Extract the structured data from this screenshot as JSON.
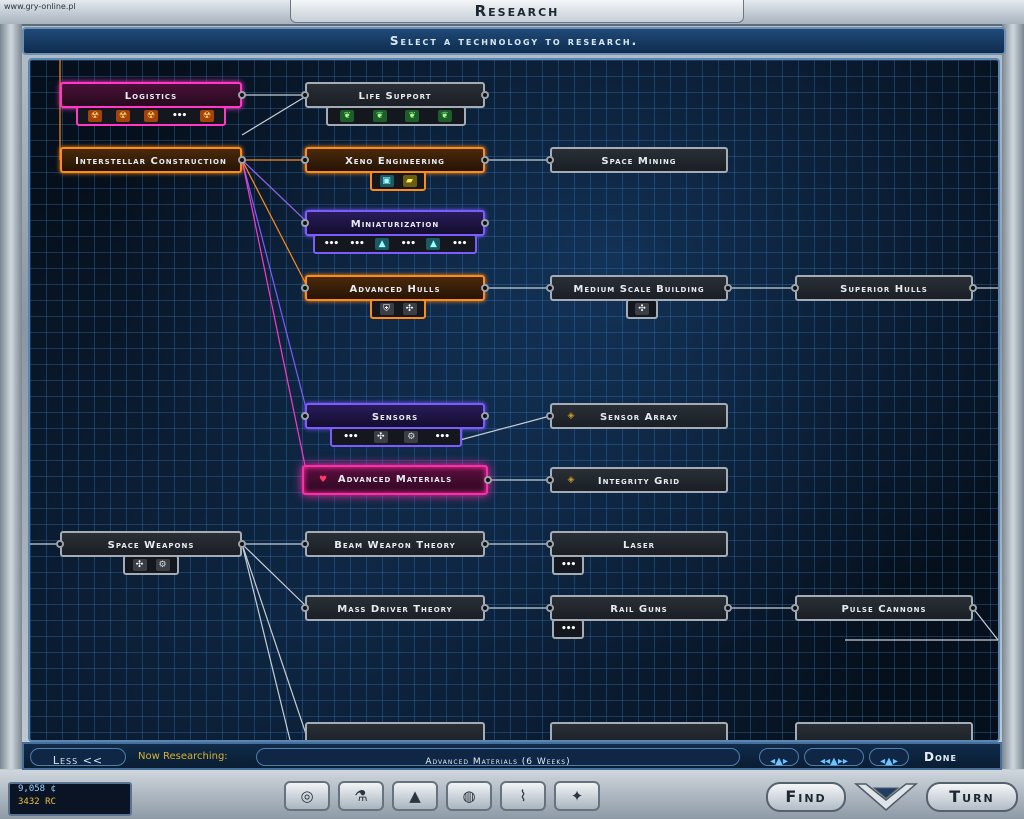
{
  "watermark": "www.gry-online.pl",
  "window": {
    "title": "Research",
    "instruction": "Select a technology to research."
  },
  "tech_tree": {
    "nodes": [
      {
        "id": "logistics",
        "label": "Logistics",
        "style": "pink"
      },
      {
        "id": "life_support",
        "label": "Life Support",
        "style": "gray"
      },
      {
        "id": "interstellar_construction",
        "label": "Interstellar Construction",
        "style": "orange"
      },
      {
        "id": "xeno_engineering",
        "label": "Xeno Engineering",
        "style": "orange"
      },
      {
        "id": "space_mining",
        "label": "Space Mining",
        "style": "gray"
      },
      {
        "id": "miniaturization",
        "label": "Miniaturization",
        "style": "purple"
      },
      {
        "id": "advanced_hulls",
        "label": "Advanced Hulls",
        "style": "orange"
      },
      {
        "id": "medium_scale_building",
        "label": "Medium Scale Building",
        "style": "gray"
      },
      {
        "id": "superior_hulls",
        "label": "Superior Hulls",
        "style": "gray"
      },
      {
        "id": "sensors",
        "label": "Sensors",
        "style": "purple"
      },
      {
        "id": "sensor_array",
        "label": "Sensor Array",
        "style": "gray"
      },
      {
        "id": "advanced_materials",
        "label": "Advanced Materials",
        "style": "selected"
      },
      {
        "id": "integrity_grid",
        "label": "Integrity Grid",
        "style": "gray"
      },
      {
        "id": "space_weapons",
        "label": "Space Weapons",
        "style": "gray"
      },
      {
        "id": "beam_weapon_theory",
        "label": "Beam Weapon Theory",
        "style": "gray"
      },
      {
        "id": "laser",
        "label": "Laser",
        "style": "gray"
      },
      {
        "id": "mass_driver_theory",
        "label": "Mass Driver Theory",
        "style": "gray"
      },
      {
        "id": "rail_guns",
        "label": "Rail Guns",
        "style": "gray"
      },
      {
        "id": "pulse_cannons",
        "label": "Pulse Cannons",
        "style": "gray"
      }
    ],
    "tray_icons": {
      "logistics": [
        "radiation-icon",
        "radiation-icon",
        "radiation-icon",
        "more-icon",
        "radiation-icon"
      ],
      "life_support": [
        "leaf-icon",
        "leaf-icon",
        "leaf-icon",
        "leaf-icon"
      ],
      "xeno_engineering": [
        "cube-icon",
        "square-icon"
      ],
      "miniaturization": [
        "more-icon",
        "more-icon",
        "tower-icon",
        "more-icon",
        "tower-icon",
        "more-icon"
      ],
      "advanced_hulls": [
        "shield-icon",
        "drone-icon"
      ],
      "medium_scale_building": [
        "drone-icon"
      ],
      "sensors": [
        "more-icon",
        "drone-icon",
        "gear-icon",
        "more-icon"
      ],
      "space_weapons": [
        "drone-icon",
        "gear-icon"
      ],
      "laser": [
        "more-icon"
      ],
      "rail_guns": [
        "more-icon"
      ]
    },
    "more_glyph": "•••"
  },
  "controls": {
    "less_label": "Less <<",
    "now_researching_label": "Now Researching:",
    "current_research": "Advanced Materials (6 Weeks)",
    "done_label": "Done"
  },
  "empire": {
    "credits": "9,058 ¢",
    "research_points": "3432 RC"
  },
  "buttons": {
    "find": "Find",
    "turn": "Turn"
  },
  "colors": {
    "pink": "#ff38c8",
    "orange": "#ff8c1a",
    "purple": "#7c5cff",
    "gray": "#a4acb5",
    "panel_bg": "#06101c",
    "gridline": "#3c78be"
  }
}
